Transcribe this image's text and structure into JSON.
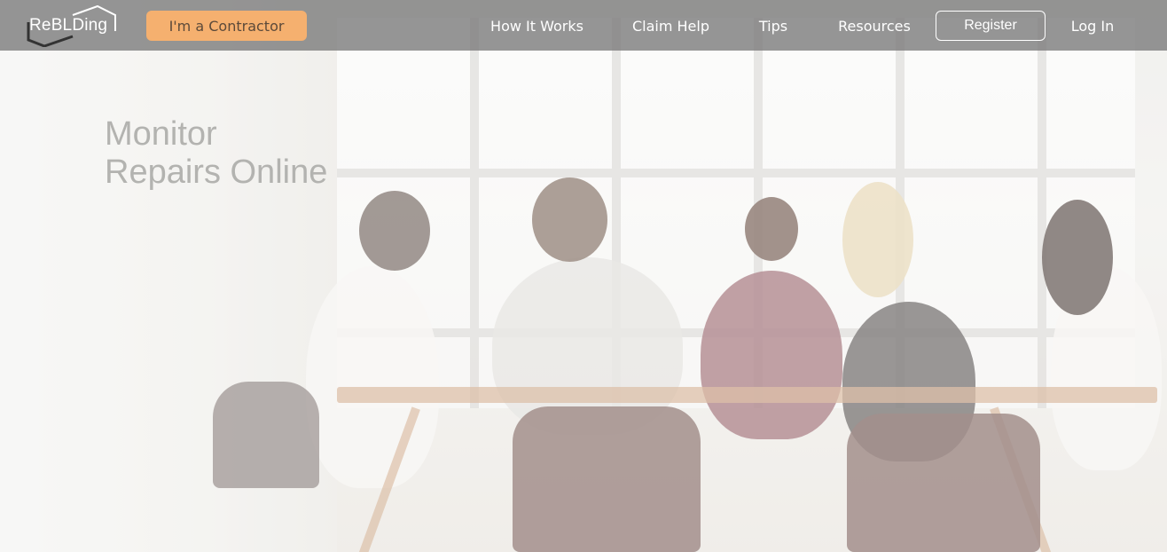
{
  "brand": {
    "logo_text": "ReBLDing"
  },
  "nav": {
    "contractor_label": "I'm a Contractor",
    "links": [
      "How It Works",
      "Claim Help",
      "Tips",
      "Resources"
    ],
    "register_label": "Register",
    "login_label": "Log In"
  },
  "hero": {
    "headline_line1": "Monitor",
    "headline_line2": "Repairs Online"
  },
  "colors": {
    "nav_bg": "#7a7a7a",
    "contractor_accent": "#f5b06f",
    "headline": "#b3b3b0"
  }
}
